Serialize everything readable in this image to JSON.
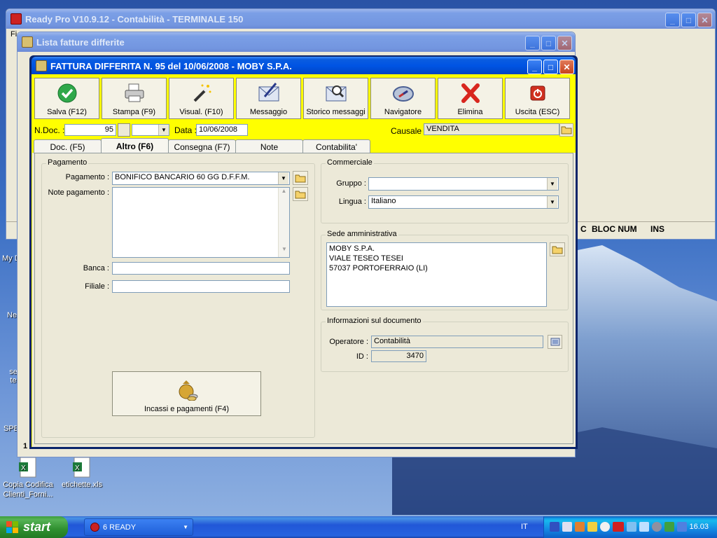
{
  "main_window": {
    "title": "Ready Pro V10.9.12 - Contabilità - TERMINALE 150",
    "menu_first": "Fi"
  },
  "list_window": {
    "title": "Lista fatture differite"
  },
  "dialog": {
    "title": "FATTURA DIFFERITA N. 95  del 10/06/2008 - MOBY S.P.A.",
    "toolbar": [
      {
        "label": "Salva (F12)",
        "icon": "check-icon"
      },
      {
        "label": "Stampa (F9)",
        "icon": "printer-icon"
      },
      {
        "label": "Visual. (F10)",
        "icon": "magic-wand-icon"
      },
      {
        "label": "Messaggio",
        "icon": "envelope-pen-icon"
      },
      {
        "label": "Storico messaggi",
        "icon": "envelope-search-icon"
      },
      {
        "label": "Navigatore",
        "icon": "compass-icon"
      },
      {
        "label": "Elimina",
        "icon": "red-x-icon"
      },
      {
        "label": "Uscita (ESC)",
        "icon": "power-icon"
      }
    ],
    "header": {
      "ndoc_label": "N.Doc. :",
      "ndoc_value": "95",
      "data_label": "Data :",
      "data_value": "10/06/2008",
      "causale_label": "Causale :",
      "causale_value": "VENDITA"
    },
    "tabs": [
      "Doc. (F5)",
      "Altro (F6)",
      "Consegna (F7)",
      "Note",
      "Contabilita'"
    ],
    "active_tab": "Altro (F6)",
    "pagamento": {
      "group_title": "Pagamento",
      "pagamento_label": "Pagamento :",
      "pagamento_value": "BONIFICO BANCARIO 60 GG D.F.F.M.",
      "note_label": "Note pagamento :",
      "note_value": "",
      "banca_label": "Banca :",
      "banca_value": "",
      "filiale_label": "Filiale :",
      "filiale_value": "",
      "incassi_button": "Incassi e pagamenti (F4)"
    },
    "commerciale": {
      "group_title": "Commerciale",
      "gruppo_label": "Gruppo :",
      "gruppo_value": "",
      "lingua_label": "Lingua :",
      "lingua_value": "Italiano"
    },
    "sede": {
      "group_title": "Sede amministrativa",
      "lines": [
        "MOBY S.P.A.",
        "VIALE TESEO TESEI",
        "57037 PORTOFERRAIO (LI)"
      ]
    },
    "info": {
      "group_title": "Informazioni sul documento",
      "operatore_label": "Operatore :",
      "operatore_value": "Contabilità",
      "id_label": "ID :",
      "id_value": "3470"
    }
  },
  "background_status": {
    "c": "C",
    "bloc_num": "BLOC NUM",
    "ins": "INS",
    "left_digit": "1"
  },
  "desktop": {
    "icons": [
      {
        "label": "Copia Codifica Clienti_Forni..."
      },
      {
        "label": "etichette.xls"
      }
    ],
    "edge_labels": [
      "My D",
      "Ne",
      "se te",
      "SPE"
    ]
  },
  "taskbar": {
    "start_label": "start",
    "task_label": "6 READY",
    "lang": "IT",
    "clock": "16.03"
  },
  "colors": {
    "dialog_border": "#0a246a",
    "yellow_bar": "#ffff00",
    "title_blue": "#0054e3"
  }
}
